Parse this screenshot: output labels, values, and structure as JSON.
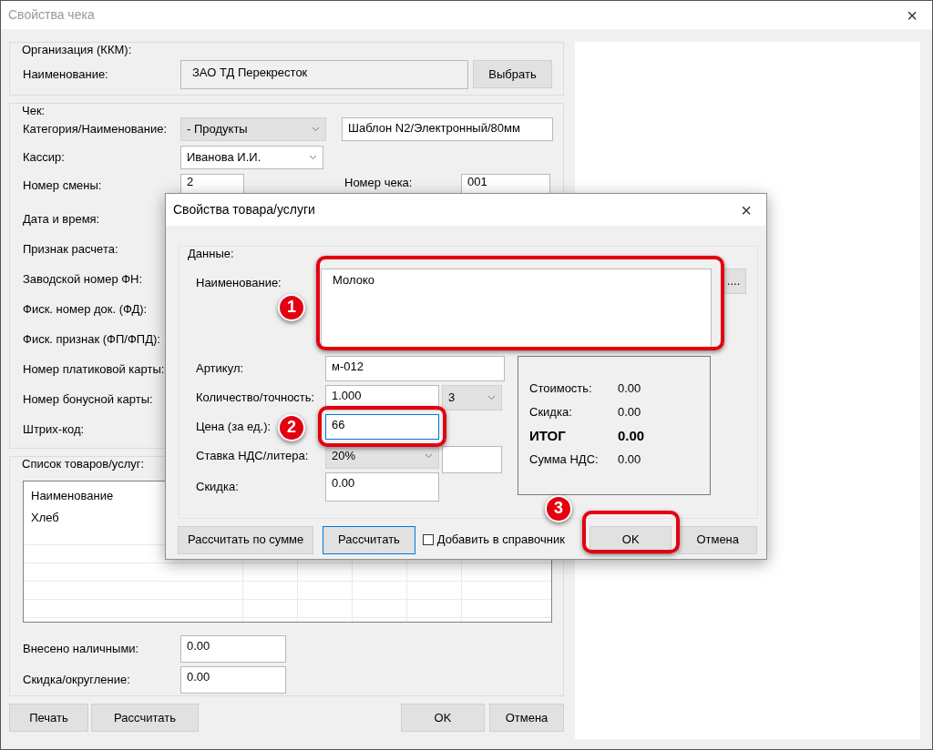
{
  "window": {
    "title": "Свойства чека",
    "close": "×"
  },
  "organization": {
    "legend": "Организация (ККМ):",
    "label": "Наименование:",
    "value": "ЗАО ТД Перекресток",
    "button": "Выбрать"
  },
  "receipt": {
    "legend": "Чек:",
    "rows": [
      {
        "label": "Категория/Наименование:",
        "controls": [
          {
            "kind": "select",
            "value": "- Продукты",
            "disabled": true
          },
          {
            "kind": "text",
            "value": "Шаблон N2/Электронный/80мм"
          }
        ]
      },
      {
        "label": "Кассир:",
        "controls": [
          {
            "kind": "select",
            "value": "Иванова И.И.",
            "disabled": false
          }
        ]
      },
      {
        "label": "Номер смены:",
        "controls": [
          {
            "kind": "text",
            "value": "2"
          },
          {
            "kind": "label",
            "value": "Номер чека:"
          },
          {
            "kind": "text",
            "value": "001"
          }
        ]
      },
      {
        "label": "Дата и время:",
        "controls": []
      },
      {
        "label": "Признак расчета:",
        "controls": []
      },
      {
        "label": "Заводской номер ФН:",
        "controls": []
      },
      {
        "label": "Фиск. номер док. (ФД):",
        "controls": []
      },
      {
        "label": "Фиск. признак (ФП/ФПД):",
        "controls": []
      },
      {
        "label": "Номер платиковой карты:",
        "controls": []
      },
      {
        "label": "Номер бонусной карты:",
        "controls": []
      },
      {
        "label": "Штрих-код:",
        "controls": []
      }
    ]
  },
  "items": {
    "legend": "Список товаров/услуг:",
    "columns": [
      "Наименование"
    ],
    "rows": [
      [
        "Хлеб"
      ]
    ],
    "totals": [
      {
        "label": "Внесено наличными:",
        "value": "0.00"
      },
      {
        "label": "Скидка/округление:",
        "value": "0.00"
      }
    ]
  },
  "buttons_left": [
    "Печать",
    "Рассчитать"
  ],
  "buttons_right": [
    "OK",
    "Отмена"
  ],
  "dialog": {
    "title": "Свойства товара/услуги",
    "close": "×",
    "legend": "Данные:",
    "name_label": "Наименование:",
    "name_value": "Молоко",
    "browse_button": "....",
    "fields": [
      {
        "label": "Артикул:",
        "controls": [
          {
            "kind": "text",
            "value": "м-012",
            "focused": false
          }
        ]
      },
      {
        "label": "Количество/точность:",
        "controls": [
          {
            "kind": "text",
            "value": "1.000",
            "focused": false
          },
          {
            "kind": "select",
            "value": "3",
            "disabled": true
          }
        ]
      },
      {
        "label": "Цена (за ед.):",
        "controls": [
          {
            "kind": "text",
            "value": "66",
            "focused": true
          }
        ]
      },
      {
        "label": "Ставка НДС/литера:",
        "controls": [
          {
            "kind": "select",
            "value": "20%",
            "disabled": true
          },
          {
            "kind": "text",
            "focused": false
          }
        ]
      },
      {
        "label": "Скидка:",
        "controls": [
          {
            "kind": "text",
            "value": "0.00",
            "focused": false
          }
        ]
      }
    ],
    "summary": [
      {
        "label": "Стоимость:",
        "value": "0.00",
        "bold": false
      },
      {
        "label": "Скидка:",
        "value": "0.00",
        "bold": false
      },
      {
        "label": "ИТОГ",
        "value": "0.00",
        "bold": true
      },
      {
        "label": "Сумма НДС:",
        "value": "0.00",
        "bold": false
      }
    ],
    "buttons": [
      {
        "label": "Рассчитать по сумме",
        "default": false
      },
      {
        "label": "Рассчитать",
        "default": true
      }
    ],
    "checkbox": {
      "label": "Добавить в справочник",
      "checked": false
    },
    "ok": "OK",
    "cancel": "Отмена"
  },
  "annotations": [
    {
      "number": "1"
    },
    {
      "number": "2"
    },
    {
      "number": "3"
    }
  ]
}
